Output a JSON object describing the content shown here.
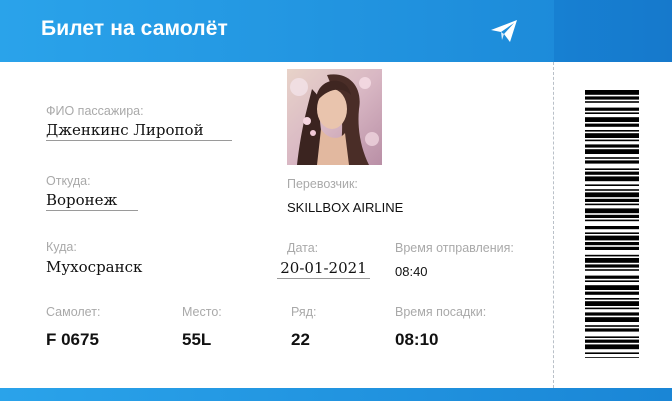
{
  "header": {
    "title": "Билет на самолёт"
  },
  "passenger": {
    "label": "ФИО пассажира:",
    "value": "Дженкинс Лиропой"
  },
  "origin": {
    "label": "Откуда:",
    "value": "Воронеж"
  },
  "destination": {
    "label": "Куда:",
    "value": "Мухосранск"
  },
  "carrier": {
    "label": "Перевозчик:",
    "value": "SKILLBOX AIRLINE"
  },
  "date": {
    "label": "Дата:",
    "value": "20-01-2021"
  },
  "departure": {
    "label": "Время отправления:",
    "value": "08:40"
  },
  "plane": {
    "label": "Самолет:",
    "value": "F 0675"
  },
  "seat": {
    "label": "Место:",
    "value": "55L"
  },
  "row": {
    "label": "Ряд:",
    "value": "22"
  },
  "boarding": {
    "label": "Время посадки:",
    "value": "08:10"
  },
  "colors": {
    "header_blue": "#1a86d6",
    "accent_blue": "#2aa3ea",
    "label_gray": "#a9a9a9"
  },
  "icons": {
    "plane": "paper-plane-icon",
    "barcode": "barcode"
  }
}
